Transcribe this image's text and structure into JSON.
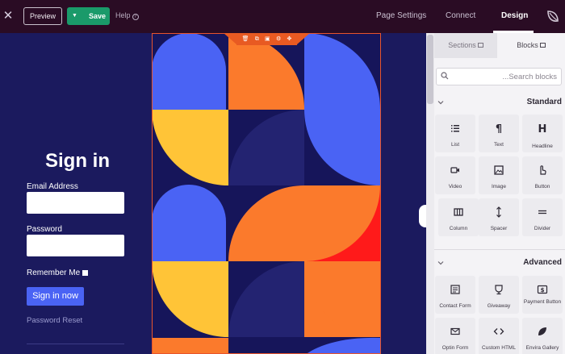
{
  "topbar": {
    "close_icon": "close-icon",
    "preview_label": "Preview",
    "save_label": "Save",
    "help_label": "Help",
    "tabs": [
      {
        "label": "Page Settings"
      },
      {
        "label": "Connect"
      },
      {
        "label": "Design"
      }
    ]
  },
  "signin": {
    "title": "Sign in",
    "email_label": "Email Address",
    "email_value": "",
    "password_label": "Password",
    "password_value": "",
    "remember_label": "Remember Me",
    "button_label": "Sign in now",
    "reset_label": "Password Reset"
  },
  "colors": {
    "topbar": "#2a0c24",
    "canvas": "#1b1a5e",
    "blue": "#4a63f4",
    "orange": "#fb7a2c",
    "yellow": "#ffc437",
    "red": "#ff1a1a",
    "navy": "#16155a",
    "save_green": "#1a9a6a",
    "toolbar_orange": "#e85a22"
  },
  "sidebar": {
    "tabs": [
      {
        "label": "Sections"
      },
      {
        "label": "Blocks"
      }
    ],
    "search_placeholder": "...Search blocks",
    "standard": {
      "title": "Standard",
      "blocks": [
        {
          "label": "List",
          "icon": "list-icon"
        },
        {
          "label": "Text",
          "icon": "paragraph-icon"
        },
        {
          "label": "Headline",
          "icon": "heading-icon"
        },
        {
          "label": "Video",
          "icon": "video-icon"
        },
        {
          "label": "Image",
          "icon": "image-icon"
        },
        {
          "label": "Button",
          "icon": "pointer-icon"
        },
        {
          "label": "Column",
          "icon": "column-icon"
        },
        {
          "label": "Spacer",
          "icon": "spacer-icon"
        },
        {
          "label": "Divider",
          "icon": "divider-icon"
        }
      ]
    },
    "advanced": {
      "title": "Advanced",
      "blocks": [
        {
          "label": "Contact Form",
          "icon": "form-icon"
        },
        {
          "label": "Giveaway",
          "icon": "trophy-icon"
        },
        {
          "label": "Payment Button",
          "icon": "dollar-icon"
        },
        {
          "label": "Optin Form",
          "icon": "mail-icon"
        },
        {
          "label": "Custom HTML",
          "icon": "code-icon"
        },
        {
          "label": "Envira Gallery",
          "icon": "leaf-icon"
        }
      ]
    }
  }
}
